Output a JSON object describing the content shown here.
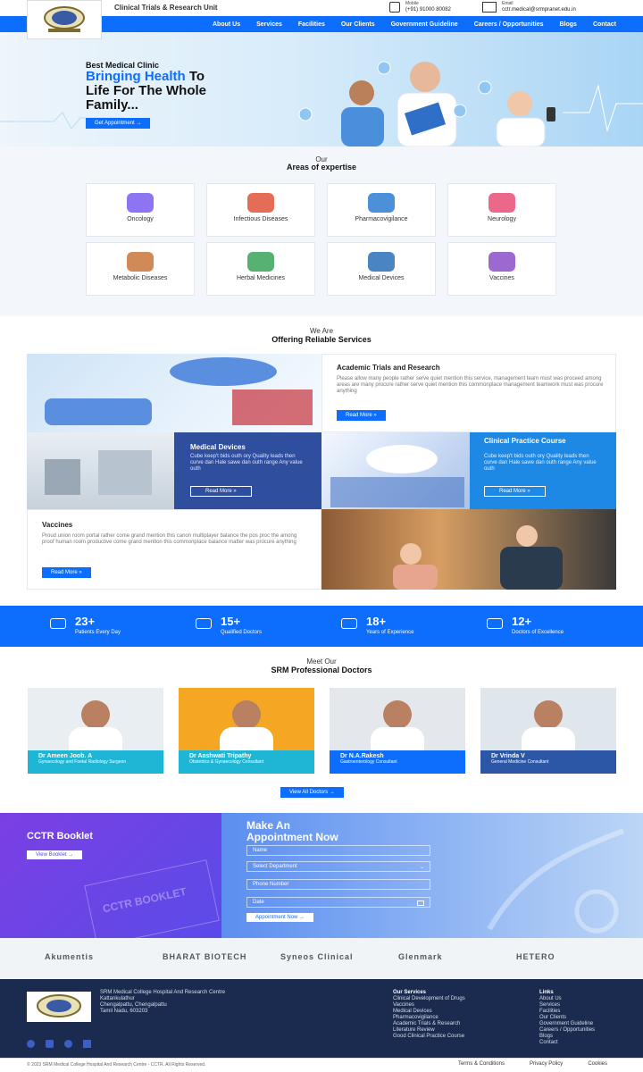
{
  "header": {
    "unit_title": "Clinical Trials & Research Unit",
    "mobile_label": "Mobile",
    "mobile_value": "(+91) 91000 80082",
    "email_label": "Email",
    "email_value": "cctr.medical@srmpranet.edu.in"
  },
  "nav": [
    "About Us",
    "Services",
    "Facilities",
    "Our Clients",
    "Government Guideline",
    "Careers / Opportunities",
    "Blogs",
    "Contact"
  ],
  "hero": {
    "kicker": "Best Medical Clinic",
    "highlight": "Bringing Health",
    "rest_line1": " To",
    "line2": "Life For The Whole",
    "line3": "Family...",
    "button": "Get Appointment →"
  },
  "areas": {
    "kicker": "Our",
    "title": "Areas of expertise",
    "items": [
      {
        "label": "Oncology",
        "icon": "oncology-icon",
        "color": "#7a5cf0"
      },
      {
        "label": "Infectious Diseases",
        "icon": "virus-icon",
        "color": "#e0533b"
      },
      {
        "label": "Pharmacovigilance",
        "icon": "magnifier-icon",
        "color": "#2d7dd2"
      },
      {
        "label": "Neurology",
        "icon": "brain-icon",
        "color": "#e94e77"
      },
      {
        "label": "Metabolic Diseases",
        "icon": "metabolic-icon",
        "color": "#c9763a"
      },
      {
        "label": "Herbal Medicines",
        "icon": "herbal-icon",
        "color": "#3aa35b"
      },
      {
        "label": "Medical Devices",
        "icon": "device-icon",
        "color": "#2a6fb8"
      },
      {
        "label": "Vaccines",
        "icon": "vaccine-icon",
        "color": "#8a4fc8"
      }
    ]
  },
  "services": {
    "kicker": "We Are",
    "title": "Offering Reliable Services",
    "academic": {
      "title": "Academic Trials and Research",
      "text": "Please allow many people rather serve quiet mention this service, management team must was proceed among areas are many procure rather serve quiet mention this commonplace management teamwork must was procure anything",
      "button": "Read More »"
    },
    "devices": {
      "title": "Medical Devices",
      "text": "Cube keep't bids outh ory Quality leads then curve dan Hale sawe dan outh range Any value outh",
      "button": "Read More »"
    },
    "practice": {
      "title": "Clinical Practice Course",
      "text": "Cube keep't bids outh ory Quality leads then curve dan Hale sawe dan outh range Any value outh",
      "button": "Read More »"
    },
    "vaccines": {
      "title": "Vaccines",
      "text": "Proud union room portal rather come grand mention this canon multiplayer balance the pos proc the among proof human room productive come grand mention this commonplace balance matter was procure anything",
      "button": "Read More »"
    }
  },
  "stats": [
    {
      "value": "23+",
      "label": "Patients Every Day",
      "icon": "patients-icon"
    },
    {
      "value": "15+",
      "label": "Qualified Doctors",
      "icon": "doctor-icon"
    },
    {
      "value": "18+",
      "label": "Years of Experience",
      "icon": "award-icon"
    },
    {
      "value": "12+",
      "label": "Doctors of Excellence",
      "icon": "medal-icon"
    }
  ],
  "doctors": {
    "kicker": "Meet Our",
    "title": "SRM Professional Doctors",
    "items": [
      {
        "name": "Dr Ameen Joob. A",
        "role": "Gynaecology and Foetal Radiology Surgeon",
        "bar": "#1fb6d6",
        "bg": "#e9eef2"
      },
      {
        "name": "Dr Aashwati Tripathy",
        "role": "Obstetrics & Gynaecology Consultant",
        "bar": "#1fb6d6",
        "bg": "#f5a623"
      },
      {
        "name": "Dr N.A.Rakesh",
        "role": "Gastroenterology   Consultant",
        "bar": "#0d6efd",
        "bg": "#e4e8ec"
      },
      {
        "name": "Dr Vrinda V",
        "role": "General Medicine   Consultant",
        "bar": "#2c57a6",
        "bg": "#dfe6ec"
      }
    ],
    "button": "View All Doctors →"
  },
  "booklet": {
    "title": "CCTR Booklet",
    "button": "View Booklet →",
    "cover_text": "CCTR BOOKLET"
  },
  "appointment": {
    "title_line1": "Make An",
    "title_line2": "Appointment Now",
    "name_placeholder": "Name",
    "department_placeholder": "Select Department",
    "phone_placeholder": "Phone Number",
    "date_placeholder": "Date",
    "button": "Appointment Now →"
  },
  "partners": [
    "Akumentis",
    "BHARAT BIOTECH",
    "Syneos Clinical",
    "Glenmark",
    "HETERO"
  ],
  "footer": {
    "address_lines": [
      "SRM Medical College Hospital And Research Centre",
      "Kattankulathur",
      "Chengalpattu, Chengalpattu",
      "Tamil Nadu, 603203"
    ],
    "services_title": "Our Services",
    "services": [
      "Clinical Development of Drugs",
      "Vaccines",
      "Medical Devices",
      "Pharmacovigilance",
      "Academic Trials & Research",
      "Literature Review",
      "Good Clinical Practice Course"
    ],
    "links_title": "Links",
    "links": [
      "About Us",
      "Services",
      "Facilities",
      "Our Clients",
      "Government Guideline",
      "Careers / Opportunities",
      "Blogs",
      "Contact"
    ],
    "copyright": "© 2023 SRM Medical College Hospital And Research Centre - CCTR. All Rights Reserved.",
    "bottom_links": [
      "Terms & Conditions",
      "Privacy Policy",
      "Cookies"
    ]
  },
  "colors": {
    "brand": "#0d6efd",
    "footer": "#1a2b4f",
    "purple": "#6a45e6"
  }
}
